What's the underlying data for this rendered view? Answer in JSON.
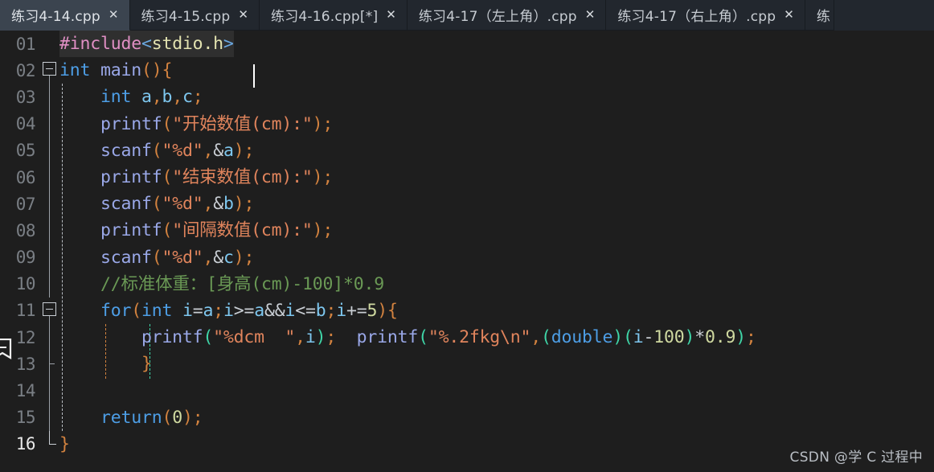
{
  "tabs": [
    {
      "label": "练习4-14.cpp",
      "close": "✕",
      "active": true,
      "partial": false
    },
    {
      "label": "练习4-15.cpp",
      "close": "✕",
      "active": false,
      "partial": false
    },
    {
      "label": "练习4-16.cpp[*]",
      "close": "✕",
      "active": false,
      "partial": false
    },
    {
      "label": "练习4-17（左上角）.cpp",
      "close": "✕",
      "active": false,
      "partial": false
    },
    {
      "label": "练习4-17（右上角）.cpp",
      "close": "✕",
      "active": false,
      "partial": false
    },
    {
      "label": "练",
      "close": "",
      "active": false,
      "partial": true
    }
  ],
  "editor": {
    "language": "C",
    "filename": "练习4-14.cpp",
    "cursor_line": 1,
    "active_line": 16,
    "bookmark_line": 12,
    "lines": [
      {
        "number": "01",
        "text": "#include<stdio.h>"
      },
      {
        "number": "02",
        "text": "int main(){"
      },
      {
        "number": "03",
        "text": "    int a,b,c;"
      },
      {
        "number": "04",
        "text": "    printf(\"开始数值(cm):\");"
      },
      {
        "number": "05",
        "text": "    scanf(\"%d\",&a);"
      },
      {
        "number": "06",
        "text": "    printf(\"结束数值(cm):\");"
      },
      {
        "number": "07",
        "text": "    scanf(\"%d\",&b);"
      },
      {
        "number": "08",
        "text": "    printf(\"间隔数值(cm):\");"
      },
      {
        "number": "09",
        "text": "    scanf(\"%d\",&c);"
      },
      {
        "number": "10",
        "text": "    //标准体重：[身高(cm)-100]*0.9"
      },
      {
        "number": "11",
        "text": "    for(int i=a;i>=a&&i<=b;i+=5){"
      },
      {
        "number": "12",
        "text": "        printf(\"%dcm  \",i);  printf(\"%.2fkg\\n\",(double)(i-100)*0.9);"
      },
      {
        "number": "13",
        "text": "        }"
      },
      {
        "number": "14",
        "text": ""
      },
      {
        "number": "15",
        "text": "    return(0);"
      },
      {
        "number": "16",
        "text": "}"
      }
    ]
  },
  "watermark": {
    "text": "CSDN @学 C 过程中"
  },
  "colors": {
    "background": "#1e1e1e",
    "tabbar_background": "#22272e",
    "active_tab_background": "#3b444f",
    "line_number": "#7a7f85",
    "active_line_number": "#e8e8e8",
    "preprocessor": "#e08fc4",
    "include_path": "#e3e3b0",
    "keyword": "#4d9ee6",
    "function": "#9aa8e8",
    "identifier": "#7ec7ef",
    "punctuation": "#d2823f",
    "string": "#e0845c",
    "number": "#cfd9a0",
    "comment": "#6a9955",
    "bracket_match": "#3fd6a8",
    "caret": "#ffffff",
    "watermark": "#b9bec4"
  }
}
